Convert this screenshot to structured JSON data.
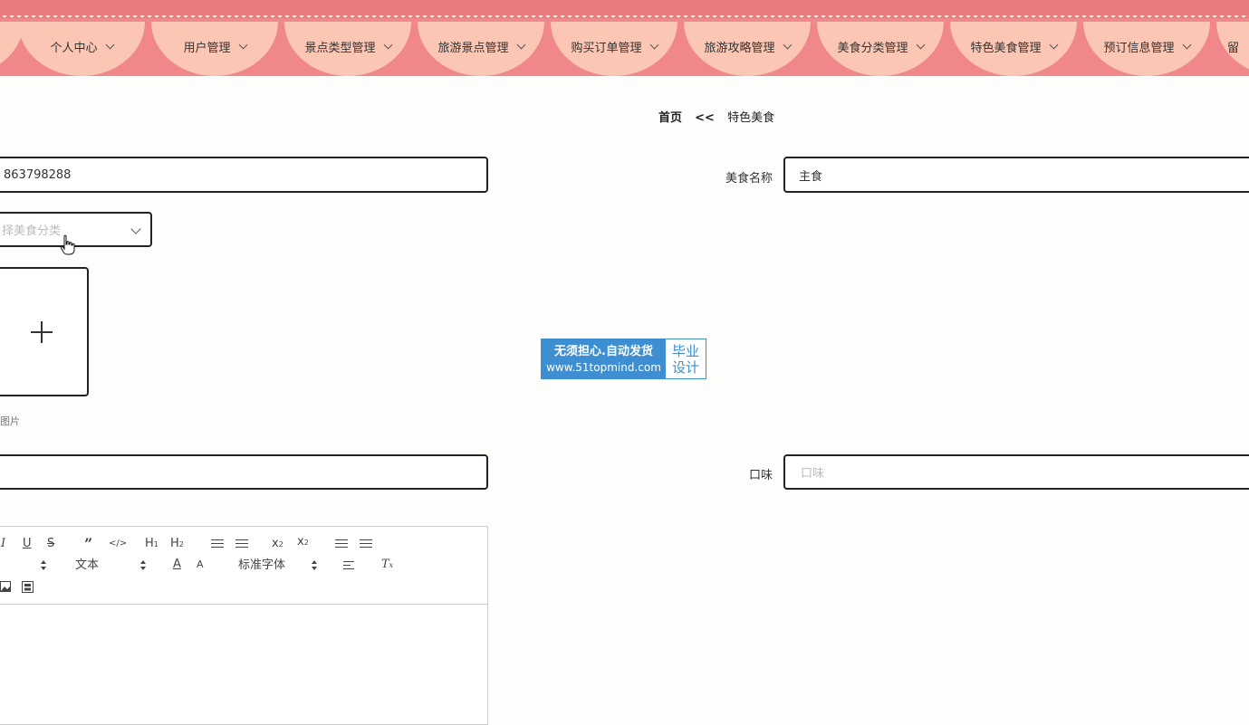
{
  "nav": {
    "items": [
      {
        "label": ""
      },
      {
        "label": "个人中心"
      },
      {
        "label": "用户管理"
      },
      {
        "label": "景点类型管理"
      },
      {
        "label": "旅游景点管理"
      },
      {
        "label": "购买订单管理"
      },
      {
        "label": "旅游攻略管理"
      },
      {
        "label": "美食分类管理"
      },
      {
        "label": "特色美食管理"
      },
      {
        "label": "预订信息管理"
      },
      {
        "label": "留"
      }
    ]
  },
  "breadcrumb": {
    "home": "首页",
    "separator": "<<",
    "current": "特色美食"
  },
  "form": {
    "code_value": "863798288",
    "food_name_label": "美食名称",
    "food_name_value": "主食",
    "category_placeholder": "择美食分类",
    "upload_tip": "图片",
    "empty_field_value": "",
    "taste_label": "口味",
    "taste_placeholder": "口味"
  },
  "editor": {
    "font_size_label": "文本",
    "font_family_label": "标准字体"
  },
  "watermark": {
    "line1": "无须担心.自动发货",
    "line2": "www.51topmind.com",
    "right1": "毕业",
    "right2": "设计"
  },
  "colors": {
    "nav_bg": "#f0878a",
    "nav_item_bg": "#fbc6b4",
    "watermark_blue": "#3d8fd1"
  }
}
